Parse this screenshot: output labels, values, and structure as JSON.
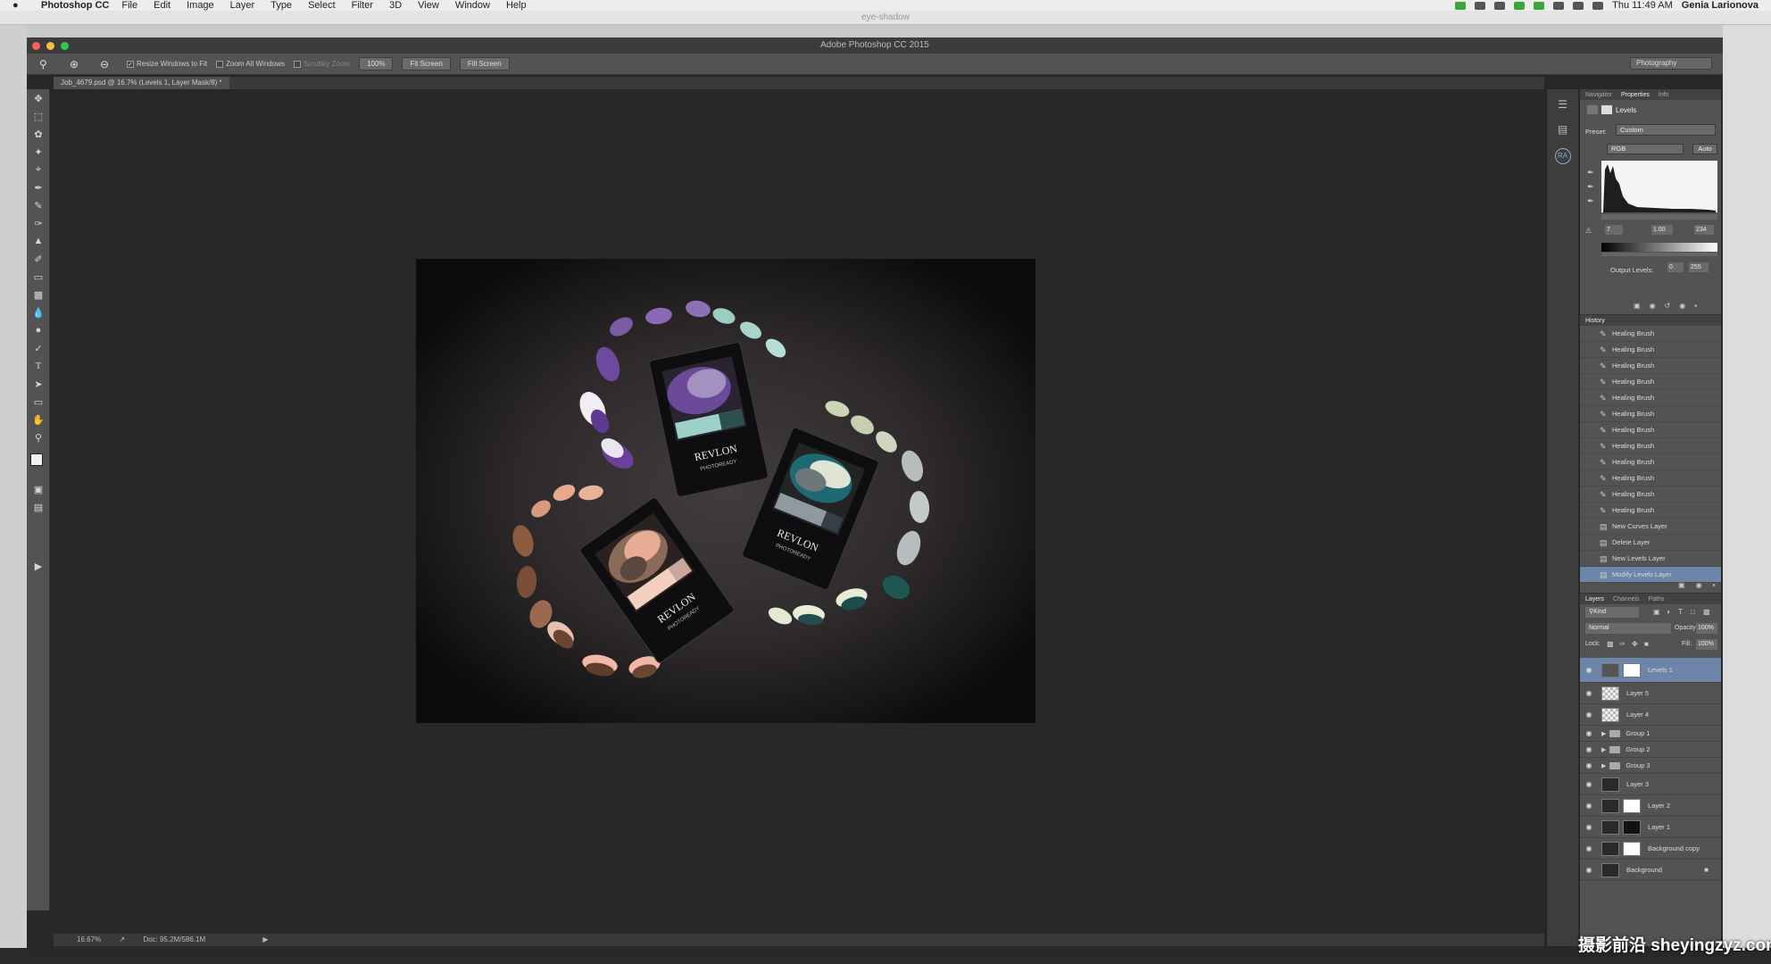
{
  "menubar": {
    "apple": "",
    "app_name": "Photoshop CC",
    "items": [
      "File",
      "Edit",
      "Image",
      "Layer",
      "Type",
      "Select",
      "Filter",
      "3D",
      "View",
      "Window",
      "Help"
    ],
    "clock": "Thu 11:49 AM",
    "user": "Genia Larionova"
  },
  "desktop": {
    "title": "eye-shadow"
  },
  "window": {
    "title": "Adobe Photoshop CC 2015"
  },
  "options_bar": {
    "resize_label": "Resize Windows to Fit",
    "zoom_all_label": "Zoom All Windows",
    "scrubby_label": "Scrubby Zoom",
    "zoom_value": "100%",
    "fit_screen": "Fit Screen",
    "fill_screen": "Fill Screen",
    "workspace": "Photography"
  },
  "document": {
    "tab": "Job_4679.psd @ 16.7% (Levels 1, Layer Mask/8) *"
  },
  "status": {
    "zoom": "16.67%",
    "doc": "Doc: 95.2M/586.1M"
  },
  "properties": {
    "tabs": [
      "Navigator",
      "Properties",
      "Info"
    ],
    "panel_title": "Levels",
    "preset_label": "Preset:",
    "preset_value": "Custom",
    "channel": "RGB",
    "auto": "Auto",
    "input_black": "7",
    "input_gamma": "1.00",
    "input_white": "234",
    "output_label": "Output Levels:",
    "output_black": "0",
    "output_white": "255"
  },
  "history": {
    "title": "History",
    "items": [
      "Healing Brush",
      "Healing Brush",
      "Healing Brush",
      "Healing Brush",
      "Healing Brush",
      "Healing Brush",
      "Healing Brush",
      "Healing Brush",
      "Healing Brush",
      "Healing Brush",
      "Healing Brush",
      "Healing Brush",
      "New Curves Layer",
      "Delete Layer",
      "New Levels Layer",
      "Modify Levels Layer"
    ]
  },
  "layers": {
    "tabs": [
      "Layers",
      "Channels",
      "Paths"
    ],
    "kind": "Kind",
    "blend": "Normal",
    "opacity_label": "Opacity:",
    "opacity": "100%",
    "lock_label": "Lock:",
    "fill_label": "Fill:",
    "fill": "100%",
    "items": [
      "Levels 1",
      "Layer 5",
      "Layer 4",
      "Group 1",
      "Group 2",
      "Group 3",
      "Layer 3",
      "Layer 2",
      "Layer 1",
      "Background copy",
      "Background"
    ]
  },
  "product": {
    "brand": "REVLON",
    "line": "PHOTOREADY"
  },
  "watermark": "摄影前沿 sheyingzyz.com",
  "colors": {
    "highlight": "#6d85a8",
    "panel": "#535353",
    "canvas": "#282828"
  }
}
